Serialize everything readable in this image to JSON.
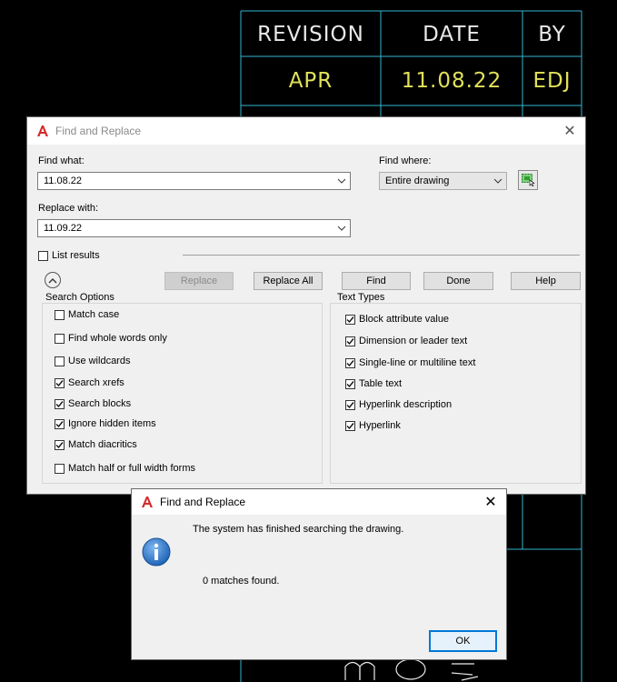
{
  "colors": {
    "cad_line": "#35b6cf",
    "titleblock_value": "#e1e15a",
    "autocad_red": "#d42b2b",
    "info_blue": "#1f65b8"
  },
  "titleblock": {
    "headers": [
      "REVISION",
      "DATE",
      "BY"
    ],
    "values": [
      "APR",
      "11.08.22",
      "EDJ"
    ]
  },
  "dialog": {
    "title": "Find and Replace",
    "app_icon": "autocad-a-icon",
    "find_what_label": "Find what:",
    "find_what_value": "11.08.22",
    "replace_with_label": "Replace with:",
    "replace_with_value": "11.09.22",
    "find_where_label": "Find where:",
    "find_where_value": "Entire drawing",
    "select_objects_icon": "select-objects-icon",
    "list_results_label": "List results",
    "list_results_checked": false,
    "buttons": {
      "replace": "Replace",
      "replace_all": "Replace All",
      "find": "Find",
      "done": "Done",
      "help": "Help"
    },
    "search_options": {
      "title": "Search Options",
      "items": [
        {
          "label": "Match case",
          "checked": false
        },
        {
          "label": "Find whole words only",
          "checked": false
        },
        {
          "label": "Use wildcards",
          "checked": false
        },
        {
          "label": "Search xrefs",
          "checked": true
        },
        {
          "label": "Search blocks",
          "checked": true
        },
        {
          "label": "Ignore hidden items",
          "checked": true
        },
        {
          "label": "Match diacritics",
          "checked": true
        },
        {
          "label": "Match half or full width forms",
          "checked": false
        }
      ]
    },
    "text_types": {
      "title": "Text Types",
      "items": [
        {
          "label": "Block attribute value",
          "checked": true
        },
        {
          "label": "Dimension or leader text",
          "checked": true
        },
        {
          "label": "Single-line or multiline text",
          "checked": true
        },
        {
          "label": "Table text",
          "checked": true
        },
        {
          "label": "Hyperlink description",
          "checked": true
        },
        {
          "label": "Hyperlink",
          "checked": true
        }
      ]
    }
  },
  "message": {
    "title": "Find and Replace",
    "line1": "The system has finished searching the drawing.",
    "line2": "0 matches found.",
    "ok_label": "OK",
    "icon": "info-icon"
  }
}
